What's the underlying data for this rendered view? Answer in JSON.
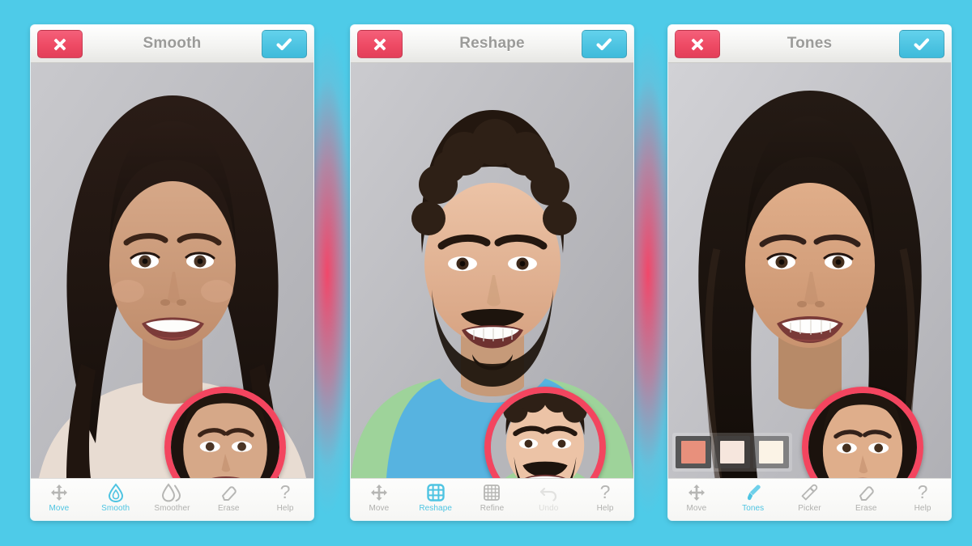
{
  "background_color": "#4ecbe8",
  "accent_color": "#4ec4e2",
  "cancel_color": "#ee4a64",
  "magnifier_color": "#f3455f",
  "panels": [
    {
      "title": "Smooth",
      "cancel_label": "Cancel",
      "confirm_label": "Done",
      "cancel_icon": "close-icon",
      "confirm_icon": "check-icon",
      "subject": "woman-dark-hair",
      "tools": [
        {
          "label": "Move",
          "icon": "move-arrows-icon",
          "state": "normal"
        },
        {
          "label": "Smooth",
          "icon": "droplet-icon",
          "state": "active"
        },
        {
          "label": "Smoother",
          "icon": "double-droplet-icon",
          "state": "normal"
        },
        {
          "label": "Erase",
          "icon": "eraser-icon",
          "state": "normal"
        },
        {
          "label": "Help",
          "icon": "question-mark-icon",
          "state": "normal"
        }
      ],
      "swatches": []
    },
    {
      "title": "Reshape",
      "cancel_label": "Cancel",
      "confirm_label": "Done",
      "cancel_icon": "close-icon",
      "confirm_icon": "check-icon",
      "subject": "man-beard",
      "tools": [
        {
          "label": "Move",
          "icon": "move-arrows-icon",
          "state": "normal"
        },
        {
          "label": "Reshape",
          "icon": "mesh-grid-icon",
          "state": "active"
        },
        {
          "label": "Refine",
          "icon": "fine-grid-icon",
          "state": "normal"
        },
        {
          "label": "Undo",
          "icon": "undo-arrow-icon",
          "state": "disabled"
        },
        {
          "label": "Help",
          "icon": "question-mark-icon",
          "state": "normal"
        }
      ],
      "swatches": []
    },
    {
      "title": "Tones",
      "cancel_label": "Cancel",
      "confirm_label": "Done",
      "cancel_icon": "close-icon",
      "confirm_icon": "check-icon",
      "subject": "woman-wavy-hair",
      "tools": [
        {
          "label": "Move",
          "icon": "move-arrows-icon",
          "state": "normal"
        },
        {
          "label": "Tones",
          "icon": "brush-icon",
          "state": "active"
        },
        {
          "label": "Picker",
          "icon": "eyedropper-icon",
          "state": "normal"
        },
        {
          "label": "Erase",
          "icon": "eraser-icon",
          "state": "normal"
        },
        {
          "label": "Help",
          "icon": "question-mark-icon",
          "state": "normal"
        }
      ],
      "swatches": [
        {
          "name": "tone-swatch-salmon",
          "color": "#e8907c",
          "selected": true
        },
        {
          "name": "tone-swatch-pale",
          "color": "#f6e6dd",
          "selected": false
        },
        {
          "name": "tone-swatch-cream",
          "color": "#fbf3e6",
          "selected": false
        }
      ]
    }
  ]
}
